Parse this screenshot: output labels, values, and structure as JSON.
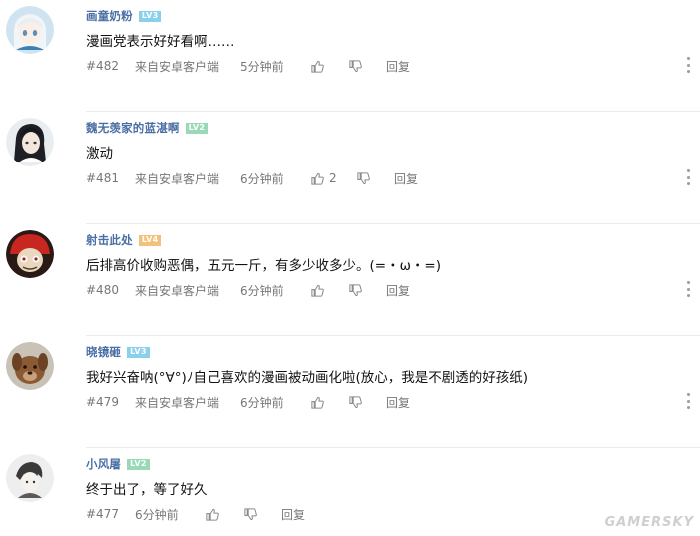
{
  "comments": [
    {
      "username": "画童奶粉",
      "level": "LV3",
      "level_color": "#8ad0ea",
      "text": "漫画党表示好好看啊……",
      "floor": "#482",
      "source": "来自安卓客户端",
      "time": "5分钟前",
      "likes": "",
      "reply": "回复",
      "avatar": "anime-girl-white-hair"
    },
    {
      "username": "魏无羡家的蓝湛啊",
      "level": "LV2",
      "level_color": "#9ad9b8",
      "text": "激动",
      "floor": "#481",
      "source": "来自安卓客户端",
      "time": "6分钟前",
      "likes": "2",
      "reply": "回复",
      "avatar": "anime-boy-black-hair"
    },
    {
      "username": "射击此处",
      "level": "LV4",
      "level_color": "#f2c27a",
      "text": "后排高价收购恶偶，五元一斤，有多少收多少。(=・ω・=)",
      "floor": "#480",
      "source": "来自安卓客户端",
      "time": "6分钟前",
      "likes": "",
      "reply": "回复",
      "avatar": "red-hat-character"
    },
    {
      "username": "晓镜砸",
      "level": "LV3",
      "level_color": "#8ad0ea",
      "text": "我好兴奋呐(°∀°)ﾉ自己喜欢的漫画被动画化啦(放心，我是不剧透的好孩纸)",
      "floor": "#479",
      "source": "来自安卓客户端",
      "time": "6分钟前",
      "likes": "",
      "reply": "回复",
      "avatar": "brown-dog"
    },
    {
      "username": "小风屠",
      "level": "LV2",
      "level_color": "#9ad9b8",
      "text": "终于出了，等了好久",
      "floor": "#477",
      "source": "",
      "time": "6分钟前",
      "likes": "",
      "reply": "回复",
      "avatar": "gray-sketch-character"
    }
  ],
  "watermark": "GAMERSKY",
  "icons": {
    "like": "thumbs-up-icon",
    "dislike": "thumbs-down-icon",
    "more": "more-vertical-icon"
  }
}
